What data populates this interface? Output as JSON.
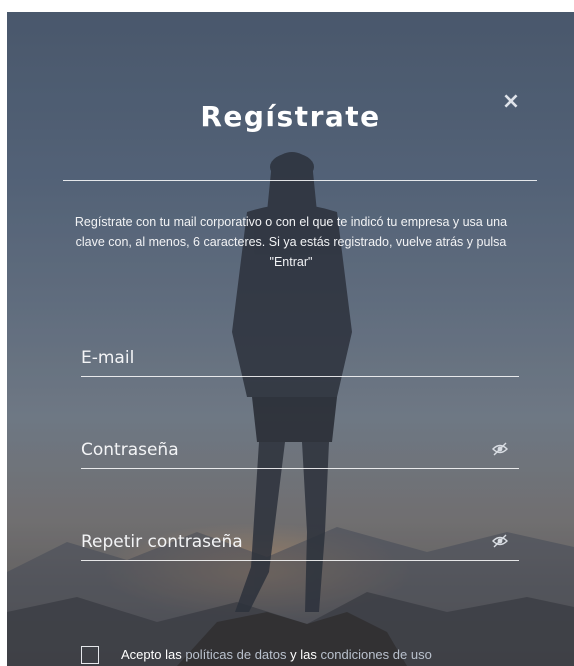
{
  "modal": {
    "title": "Regístrate",
    "close_label": "×",
    "intro": "Regístrate con tu mail corporativo o con el que te indicó tu empresa y usa una clave con, al menos, 6 caracteres. Si ya estás registrado, vuelve atrás y pulsa \"Entrar\""
  },
  "form": {
    "email": {
      "placeholder": "E-mail",
      "value": ""
    },
    "password": {
      "placeholder": "Contraseña",
      "value": "",
      "icon": "eye-slash-icon"
    },
    "repeat_password": {
      "placeholder": "Repetir contraseña",
      "value": "",
      "icon": "eye-slash-icon"
    }
  },
  "consent": {
    "checked": false,
    "prefix": "Acepto las",
    "privacy_link": "políticas de datos",
    "middle": "y las",
    "terms_link": "condiciones de uso"
  },
  "colors": {
    "text": "#ffffff",
    "link": "#b9c1cd",
    "divider": "#ffffff"
  }
}
